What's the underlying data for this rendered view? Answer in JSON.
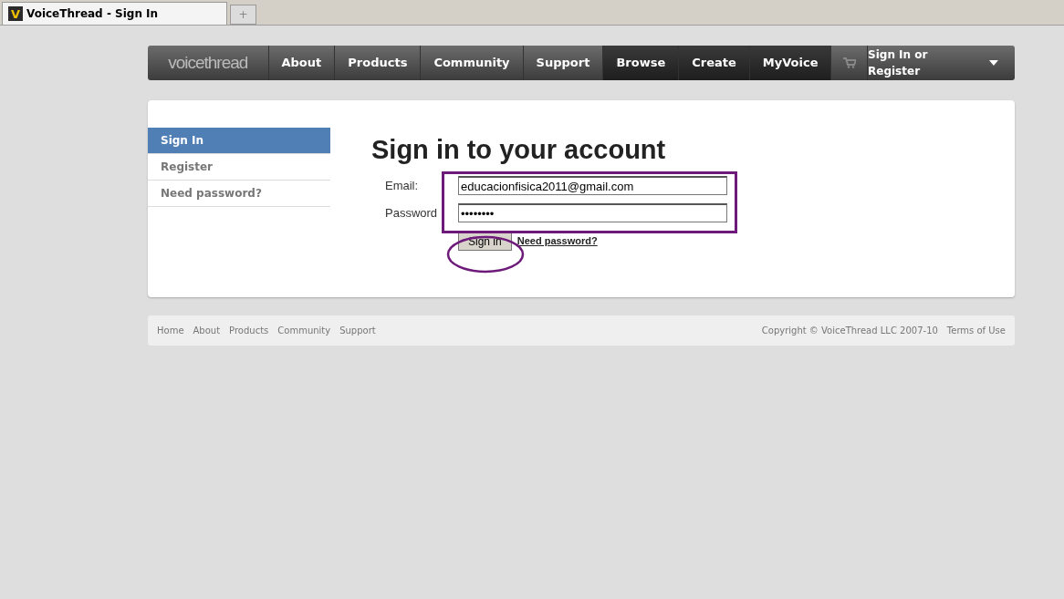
{
  "browser_tab": {
    "title": "VoiceThread - Sign In",
    "logo_letter": "V",
    "new_tab": "+"
  },
  "nav": {
    "logo": "voicethread",
    "items": [
      {
        "label": "About",
        "dark": false
      },
      {
        "label": "Products",
        "dark": false
      },
      {
        "label": "Community",
        "dark": false
      },
      {
        "label": "Support",
        "dark": false
      },
      {
        "label": "Browse",
        "dark": true
      },
      {
        "label": "Create",
        "dark": true
      },
      {
        "label": "MyVoice",
        "dark": true
      }
    ],
    "account": "Sign In or Register"
  },
  "sidebar": {
    "items": [
      {
        "label": "Sign In",
        "selected": true
      },
      {
        "label": "Register",
        "selected": false
      },
      {
        "label": "Need password?",
        "selected": false
      }
    ]
  },
  "form": {
    "title": "Sign in to your account",
    "fields": [
      {
        "label": "Email:",
        "value": "educacionfisica2011@gmail.com"
      },
      {
        "label": "Password",
        "value": "••••••••"
      }
    ],
    "submit": "Sign in",
    "link": "Need password?"
  },
  "footer": {
    "links": [
      "Home",
      "About",
      "Products",
      "Community",
      "Support"
    ],
    "copyright": "Copyright © VoiceThread LLC 2007-10",
    "terms": "Terms of Use"
  }
}
